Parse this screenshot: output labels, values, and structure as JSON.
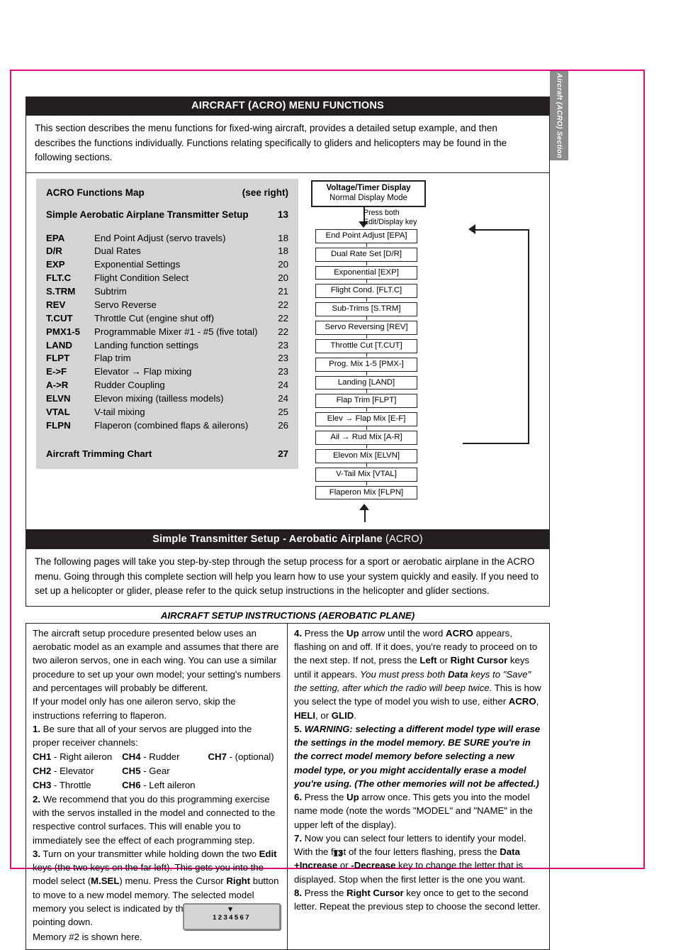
{
  "side_tab": {
    "label": "Aircraft (ACRO) Section"
  },
  "page_number": "13",
  "section1": {
    "title": "AIRCRAFT (ACRO) MENU FUNCTIONS",
    "intro": "This section describes the menu functions for fixed-wing aircraft, provides a detailed setup example, and then describes the functions individually.  Functions relating specifically to gliders and helicopters may be found in the following sections."
  },
  "functions_map": {
    "heading": "ACRO Functions Map",
    "heading_note": "(see right)",
    "subheading": "Simple Aerobatic Airplane Transmitter Setup",
    "subheading_page": "13",
    "rows": [
      {
        "abbr": "EPA",
        "desc": "End Point Adjust (servo travels)",
        "page": "18"
      },
      {
        "abbr": "D/R",
        "desc": "Dual Rates",
        "page": "18"
      },
      {
        "abbr": "EXP",
        "desc": "Exponential Settings",
        "page": "20"
      },
      {
        "abbr": "FLT.C",
        "desc": "Flight Condition Select",
        "page": "20"
      },
      {
        "abbr": "S.TRM",
        "desc": "Subtrim",
        "page": "21"
      },
      {
        "abbr": "REV",
        "desc": "Servo Reverse",
        "page": "22"
      },
      {
        "abbr": "T.CUT",
        "desc": "Throttle Cut (engine shut off)",
        "page": "22"
      },
      {
        "abbr": "PMX1-5",
        "desc": "Programmable Mixer #1 - #5 (five total)",
        "page": "22"
      },
      {
        "abbr": "LAND",
        "desc": "Landing function settings",
        "page": "23"
      },
      {
        "abbr": "FLPT",
        "desc": "Flap trim",
        "page": "23"
      },
      {
        "abbr": "E->F",
        "desc": "Elevator → Flap mixing",
        "page": "23"
      },
      {
        "abbr": "A->R",
        "desc": "Rudder Coupling",
        "page": "24"
      },
      {
        "abbr": "ELVN",
        "desc": "Elevon mixing (tailless models)",
        "page": "24"
      },
      {
        "abbr": "VTAL",
        "desc": "V-tail mixing",
        "page": "25"
      },
      {
        "abbr": "FLPN",
        "desc": "Flaperon (combined flaps & ailerons)",
        "page": "26"
      }
    ],
    "footer": "Aircraft Trimming Chart",
    "footer_page": "27"
  },
  "flowchart": {
    "top_line1": "Voltage/Timer Display",
    "top_line2": "Normal Display Mode",
    "press_note_line1": "Press both",
    "press_note_line2": "Edit/Display key",
    "boxes": [
      "End Point Adjust [EPA]",
      "Dual Rate Set [D/R]",
      "Exponential [EXP]",
      "Flight Cond. [FLT.C]",
      "Sub-Trims [S.TRM]",
      "Servo Reversing [REV]",
      "Throttle Cut [T.CUT]",
      "Prog. Mix 1-5 [PMX-]",
      "Landing [LAND]",
      "Flap Trim [FLPT]",
      "Elev → Flap Mix [E-F]",
      "Ail → Rud Mix [A-R]",
      "Elevon Mix [ELVN]",
      "V-Tail Mix [VTAL]",
      "Flaperon Mix [FLPN]"
    ]
  },
  "section2": {
    "title_bold": "Simple Transmitter Setup - Aerobatic Airplane ",
    "title_light": "(ACRO)",
    "intro": "The following pages will take you step-by-step through the setup process for a sport or aerobatic airplane in the ACRO menu.  Going through this complete section will help you learn how to use your system quickly and easily.  If you need to set up a helicopter or glider, please refer to the quick setup instructions in the helicopter and glider sections.",
    "caption": "AIRCRAFT SETUP INSTRUCTIONS (AEROBATIC PLANE)"
  },
  "left_column": {
    "para_intro": "The aircraft setup procedure presented below uses an aerobatic model as an example and assumes that there are two aileron servos, one in each wing. You can use a similar procedure to set up your own model; your setting's numbers and percentages will probably be different.",
    "para_flaperon": "If your model only has one aileron servo, skip the instructions referring to flaperon.",
    "step1_num": "1.",
    "step1_text": " Be sure that all of your servos are plugged into the proper receiver channels:",
    "channels_col1": [
      {
        "ch": "CH1",
        "name": " - Right aileron"
      },
      {
        "ch": "CH2",
        "name": " - Elevator"
      },
      {
        "ch": "CH3",
        "name": " - Throttle"
      }
    ],
    "channels_col2": [
      {
        "ch": "CH4",
        "name": " - Rudder"
      },
      {
        "ch": "CH5",
        "name": " - Gear"
      },
      {
        "ch": "CH6",
        "name": " - Left aileron"
      }
    ],
    "channels_col3": [
      {
        "ch": "CH7",
        "name": " - (optional)"
      }
    ],
    "step2_num": "2.",
    "step2_text": " We recommend that you do this programming exercise with the servos installed in the model and connected to the respective control surfaces.  This will enable you to immediately see the effect of each programming step.",
    "step3_num": "3.",
    "step3_a": " Turn on your transmitter while holding down the two ",
    "step3_b1": "Edit",
    "step3_c": " keys (the two keys on the far left).  This gets you into the model select (",
    "step3_b2": "M.SEL",
    "step3_d": ") menu.  Press the Cursor ",
    "step3_b3": "Right",
    "step3_e": " button to move to a new model memory.  The selected model memory you select is indicated by the little flashing arrow pointing down.",
    "memory_note": "Memory #2 is shown here.",
    "lcd_marker": "▼",
    "lcd_digits": "1234567"
  },
  "right_column": {
    "step4_num": "4.",
    "step4_a": " Press the ",
    "step4_b1": "Up",
    "step4_c": " arrow until the word ",
    "step4_b2": "ACRO",
    "step4_d": " appears, flashing on and off.  If it does, you're ready to proceed on to the next step.  If not, press the ",
    "step4_b3": "Left",
    "step4_e": " or ",
    "step4_b4": "Right Cursor",
    "step4_f": " keys until it appears.  ",
    "step4_i1": "You must press both ",
    "step4_bi1": "Data",
    "step4_i2": " keys to \"Save\" the setting, after which the radio will beep twice.",
    "step4_g": "  This is how you select the type of model you wish to use, either ",
    "step4_b5": "ACRO",
    "step4_h": ", ",
    "step4_b6": "HELI",
    "step4_j": ", or ",
    "step4_b7": "GLID",
    "step4_k": ".",
    "step5_num": "5.",
    "step5_text": " WARNING: selecting a different model type will erase the settings in the model memory.  BE SURE you're in the correct model memory before selecting  a new model type, or you might accidentally erase a model you're using. (The other memories will not be affected.)",
    "step6_num": "6.",
    "step6_a": " Press the ",
    "step6_b1": "Up",
    "step6_c": " arrow once.  This gets you into the model name mode (note the words \"MODEL\" and \"NAME\" in the upper left of the display).",
    "step7_num": "7.",
    "step7_a": " Now you can select four letters to identify your model. With the first of the four letters flashing, press the ",
    "step7_b1": "Data +Increase",
    "step7_c": " or ",
    "step7_b2": "-Decrease",
    "step7_d": " key to change the letter that is displayed.  Stop when the first letter is the one you want.",
    "step8_num": "8.",
    "step8_a": " Press the ",
    "step8_b1": "Right Cursor",
    "step8_c": " key once to get to the second letter.  Repeat the previous step to choose the second letter."
  }
}
